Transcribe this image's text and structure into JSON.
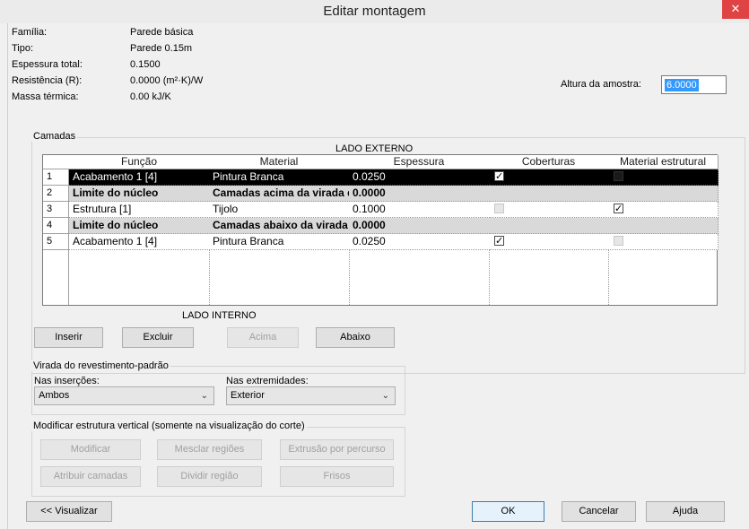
{
  "window": {
    "title": "Editar montagem",
    "close_symbol": "✕"
  },
  "info": {
    "familia_label": "Família:",
    "familia_value": "Parede básica",
    "tipo_label": "Tipo:",
    "tipo_value": "Parede 0.15m",
    "espessura_label": "Espessura total:",
    "espessura_value": "0.1500",
    "resistencia_label": "Resistência (R):",
    "resistencia_value": "0.0000 (m²·K)/W",
    "massa_label": "Massa térmica:",
    "massa_value": "0.00 kJ/K",
    "altura_label": "Altura da amostra:",
    "altura_value": "6.0000"
  },
  "layers": {
    "group_title": "Camadas",
    "exterior_label": "LADO EXTERNO",
    "interior_label": "LADO INTERNO",
    "columns": [
      "Função",
      "Material",
      "Espessura",
      "Coberturas",
      "Material estrutural"
    ],
    "rows": [
      {
        "num": "1",
        "funcao": "Acabamento 1 [4]",
        "material": "Pintura Branca",
        "espessura": "0.0250"
      },
      {
        "num": "2",
        "funcao": "Limite do núcleo",
        "material": "Camadas acima da virada d",
        "espessura": "0.0000"
      },
      {
        "num": "3",
        "funcao": "Estrutura [1]",
        "material": "Tijolo",
        "espessura": "0.1000"
      },
      {
        "num": "4",
        "funcao": "Limite do núcleo",
        "material": "Camadas abaixo da virada",
        "espessura": "0.0000"
      },
      {
        "num": "5",
        "funcao": "Acabamento 1 [4]",
        "material": "Pintura Branca",
        "espessura": "0.0250"
      }
    ],
    "buttons": {
      "inserir": "Inserir",
      "excluir": "Excluir",
      "acima": "Acima",
      "abaixo": "Abaixo"
    }
  },
  "wrap": {
    "group_title": "Virada do revestimento-padrão",
    "insercoes_label": "Nas inserções:",
    "insercoes_value": "Ambos",
    "extremidades_label": "Nas extremidades:",
    "extremidades_value": "Exterior"
  },
  "vertical": {
    "group_title": "Modificar estrutura vertical (somente na visualização do corte)",
    "modificar": "Modificar",
    "mesclar": "Mesclar regiões",
    "extrusao": "Extrusão por percurso",
    "atribuir": "Atribuir camadas",
    "dividir": "Dividir região",
    "frisos": "Frisos"
  },
  "footer": {
    "visualizar": "<< Visualizar",
    "ok": "OK",
    "cancelar": "Cancelar",
    "ajuda": "Ajuda"
  },
  "colors": {
    "selection": "#3399ff",
    "close": "#e04343",
    "core_row": "#d9d9d9"
  }
}
